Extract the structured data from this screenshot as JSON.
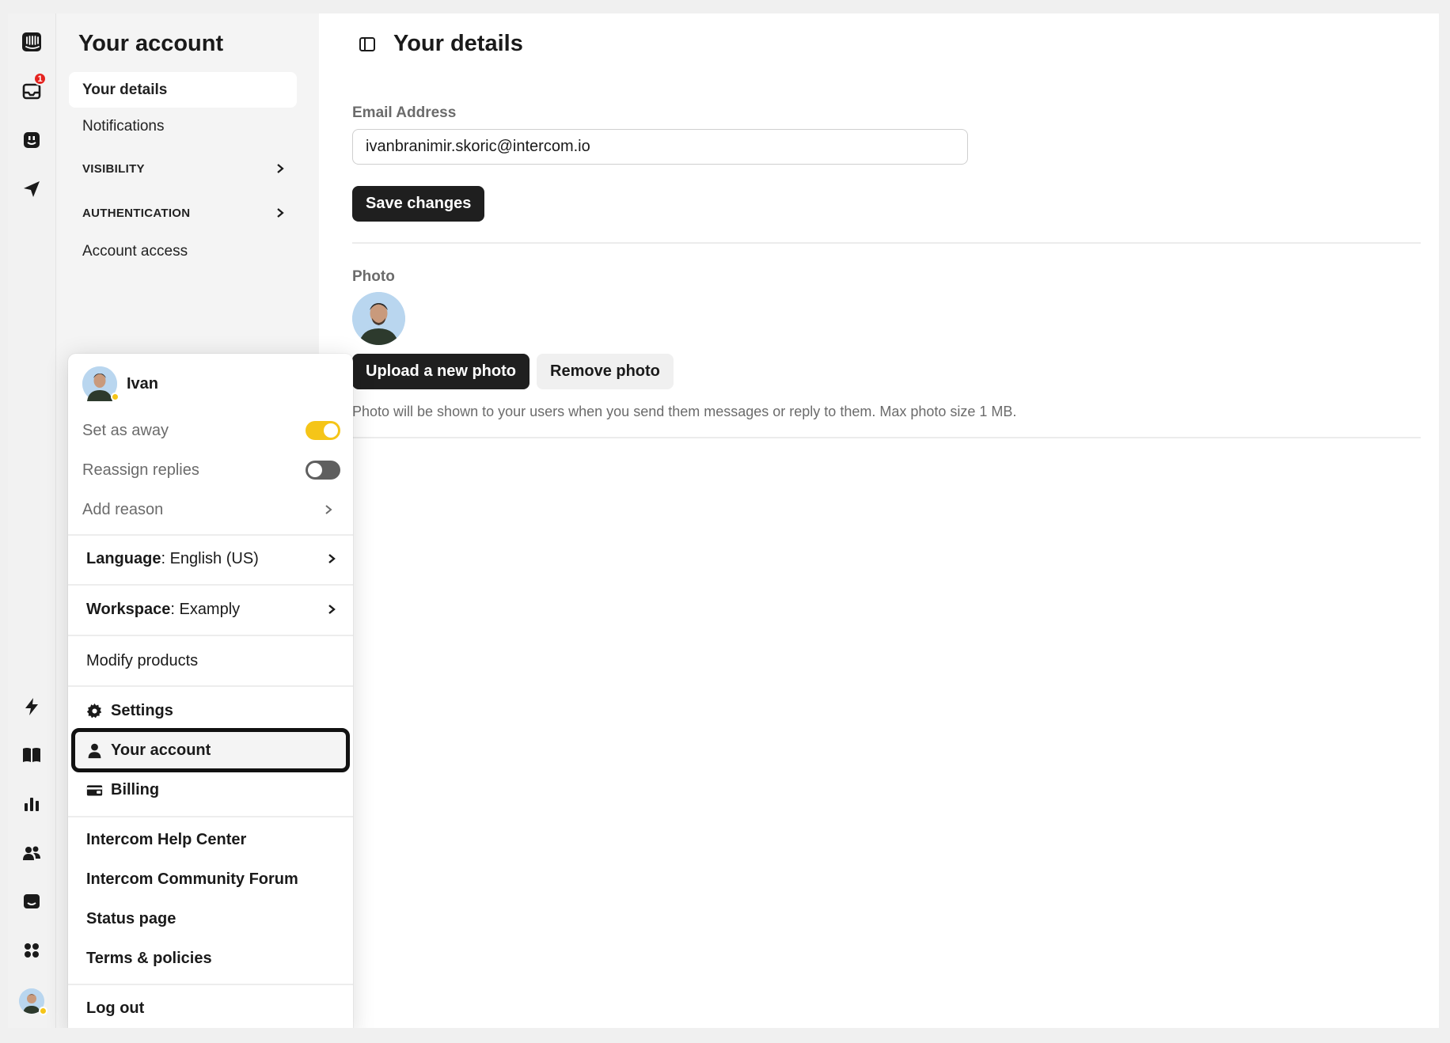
{
  "sidebar": {
    "title": "Your account",
    "items": [
      {
        "label": "Your details",
        "active": true
      },
      {
        "label": "Notifications"
      },
      {
        "label": "VISIBILITY",
        "section": true
      },
      {
        "label": "AUTHENTICATION",
        "section": true
      },
      {
        "label": "Account access"
      }
    ]
  },
  "rail": {
    "icons": [
      "intercom-logo-icon",
      "inbox-icon",
      "fin-icon",
      "outbound-icon",
      "lightning-icon",
      "knowledge-book-icon",
      "reports-icon",
      "contacts-icon",
      "messenger-icon",
      "apps-icon"
    ],
    "inbox_badge": "1"
  },
  "main": {
    "title": "Your details",
    "email_label": "Email Address",
    "email_value": "ivanbranimir.skoric@intercom.io",
    "save_label": "Save changes",
    "photo_label": "Photo",
    "upload_label": "Upload a new photo",
    "remove_label": "Remove photo",
    "photo_hint": "Photo will be shown to your users when you send them messages or reply to them. Max photo size 1 MB."
  },
  "menu": {
    "user_name": "Ivan",
    "set_away_label": "Set as away",
    "set_away_on": true,
    "reassign_label": "Reassign replies",
    "reassign_on": false,
    "add_reason_label": "Add reason",
    "language_key": "Language",
    "language_value": ": English (US)",
    "workspace_key": "Workspace",
    "workspace_value": ": Examply",
    "modify_products": "Modify products",
    "settings": "Settings",
    "your_account": "Your account",
    "billing": "Billing",
    "help_center": "Intercom Help Center",
    "community": "Intercom Community Forum",
    "status_page": "Status page",
    "terms": "Terms & policies",
    "logout": "Log out"
  },
  "colors": {
    "accent_yellow": "#f5c518",
    "badge_red": "#e5231f",
    "button_dark": "#1f1f1f"
  }
}
